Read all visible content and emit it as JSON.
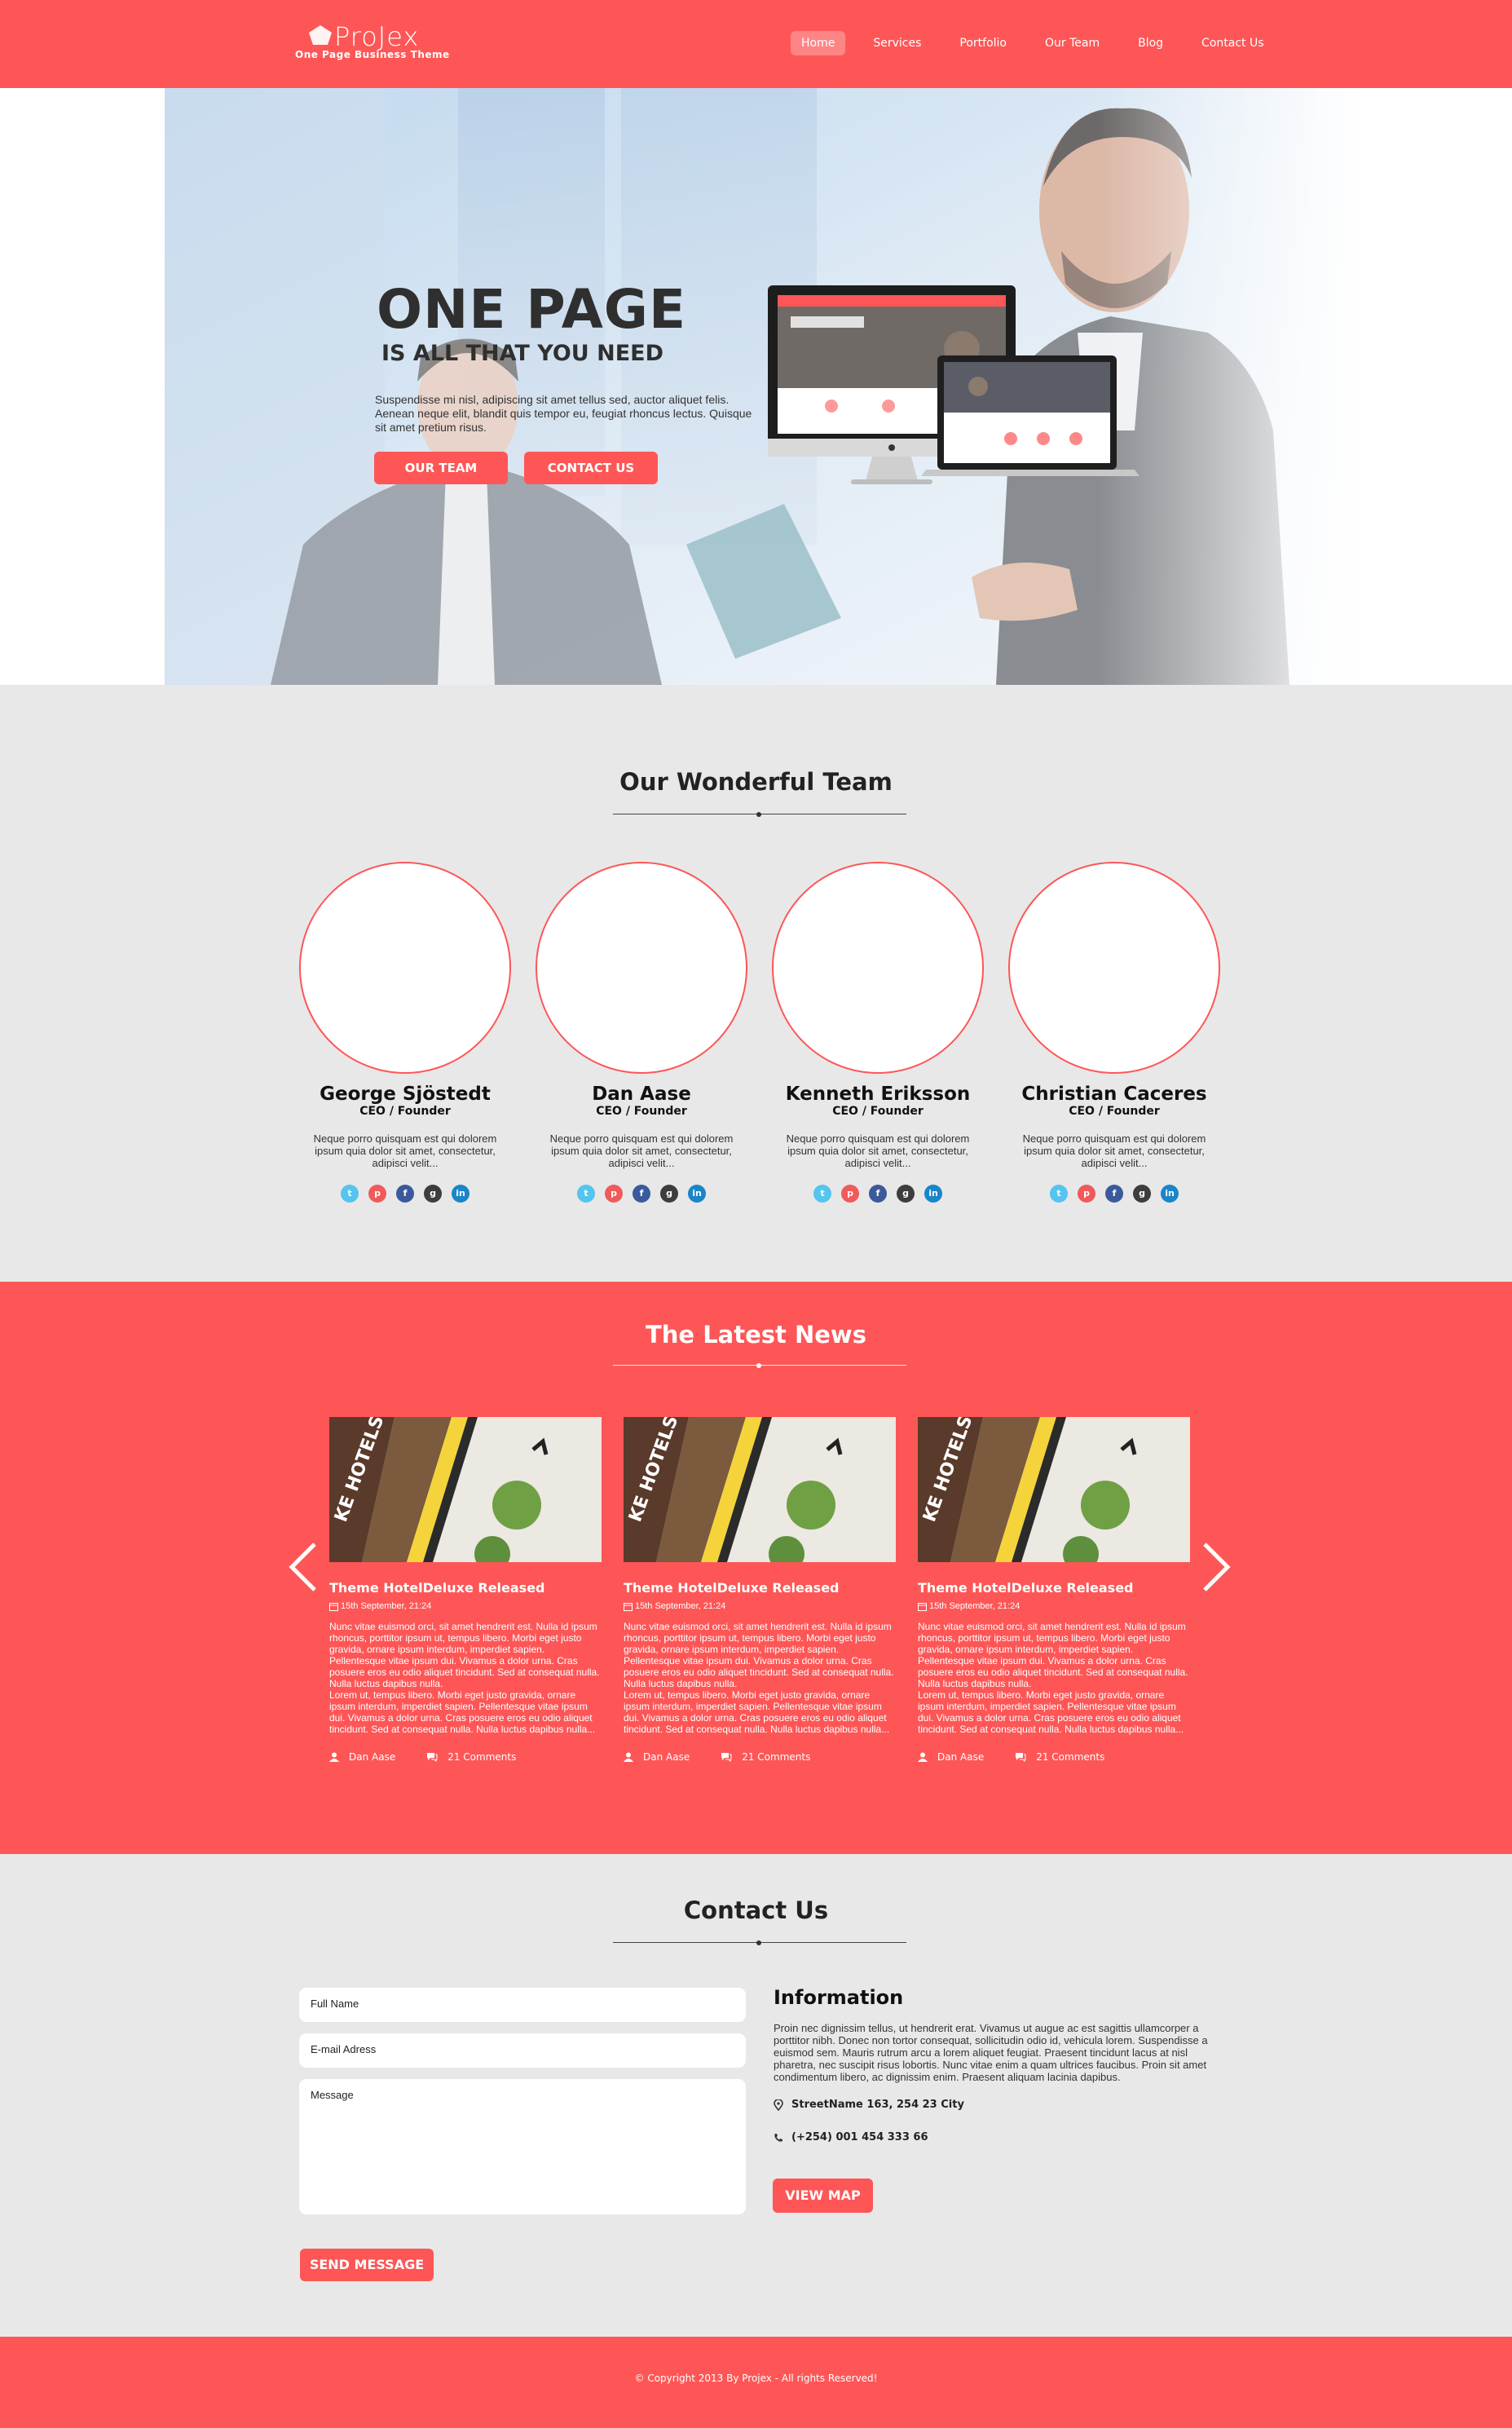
{
  "header": {
    "logo_name": "ProJex",
    "logo_tagline": "One Page Business Theme",
    "nav": [
      "Home",
      "Services",
      "Portfolio",
      "Our Team",
      "Blog",
      "Contact Us"
    ],
    "active_nav": "Home"
  },
  "hero": {
    "title": "ONE PAGE",
    "subtitle": "IS ALL THAT YOU NEED",
    "description": "Suspendisse mi nisl, adipiscing sit amet tellus sed, auctor aliquet felis. Aenean neque elit, blandit quis tempor eu, feugiat rhoncus lectus. Quisque sit amet pretium risus.",
    "button_team": "OUR TEAM",
    "button_contact": "CONTACT US"
  },
  "team": {
    "title": "Our Wonderful Team",
    "members": [
      {
        "name": "George Sjöstedt",
        "role": "CEO / Founder",
        "bio": "Neque porro quisquam est qui dolorem ipsum quia dolor sit amet, consectetur, adipisci velit..."
      },
      {
        "name": "Dan Aase",
        "role": "CEO / Founder",
        "bio": "Neque porro quisquam est qui dolorem ipsum quia dolor sit amet, consectetur, adipisci velit..."
      },
      {
        "name": "Kenneth Eriksson",
        "role": "CEO / Founder",
        "bio": "Neque porro quisquam est qui dolorem ipsum quia dolor sit amet, consectetur, adipisci velit..."
      },
      {
        "name": "Christian Caceres",
        "role": "CEO / Founder",
        "bio": "Neque porro quisquam est qui dolorem ipsum quia dolor sit amet, consectetur, adipisci velit..."
      }
    ],
    "social_icons": [
      "twitter-icon",
      "pinterest-icon",
      "facebook-icon",
      "google-plus-icon",
      "linkedin-icon"
    ]
  },
  "news": {
    "title": "The Latest News",
    "posts": [
      {
        "title": "Theme HotelDeluxe Released",
        "date": "15th September, 21:24",
        "body": "Nunc vitae euismod orci, sit amet hendrerit est. Nulla id ipsum rhoncus, porttitor ipsum ut, tempus libero. Morbi eget justo gravida, ornare ipsum interdum, imperdiet sapien. Pellentesque vitae ipsum dui. Vivamus a dolor urna. Cras posuere eros eu odio aliquet tincidunt. Sed at consequat nulla. Nulla luctus dapibus nulla.",
        "body2": "Lorem ut, tempus libero. Morbi eget justo gravida, ornare ipsum interdum, imperdiet sapien. Pellentesque vitae ipsum dui. Vivamus a dolor urna. Cras posuere eros eu odio aliquet tincidunt. Sed at consequat nulla. Nulla luctus dapibus nulla...",
        "author": "Dan Aase",
        "comments": "21 Comments",
        "image_text": "KE HOTELS"
      },
      {
        "title": "Theme HotelDeluxe Released",
        "date": "15th September, 21:24",
        "body": "Nunc vitae euismod orci, sit amet hendrerit est. Nulla id ipsum rhoncus, porttitor ipsum ut, tempus libero. Morbi eget justo gravida, ornare ipsum interdum, imperdiet sapien. Pellentesque vitae ipsum dui. Vivamus a dolor urna. Cras posuere eros eu odio aliquet tincidunt. Sed at consequat nulla. Nulla luctus dapibus nulla.",
        "body2": "Lorem ut, tempus libero. Morbi eget justo gravida, ornare ipsum interdum, imperdiet sapien. Pellentesque vitae ipsum dui. Vivamus a dolor urna. Cras posuere eros eu odio aliquet tincidunt. Sed at consequat nulla. Nulla luctus dapibus nulla...",
        "author": "Dan Aase",
        "comments": "21 Comments",
        "image_text": "KE HOTELS"
      },
      {
        "title": "Theme HotelDeluxe Released",
        "date": "15th September, 21:24",
        "body": "Nunc vitae euismod orci, sit amet hendrerit est. Nulla id ipsum rhoncus, porttitor ipsum ut, tempus libero. Morbi eget justo gravida, ornare ipsum interdum, imperdiet sapien. Pellentesque vitae ipsum dui. Vivamus a dolor urna. Cras posuere eros eu odio aliquet tincidunt. Sed at consequat nulla. Nulla luctus dapibus nulla.",
        "body2": "Lorem ut, tempus libero. Morbi eget justo gravida, ornare ipsum interdum, imperdiet sapien. Pellentesque vitae ipsum dui. Vivamus a dolor urna. Cras posuere eros eu odio aliquet tincidunt. Sed at consequat nulla. Nulla luctus dapibus nulla...",
        "author": "Dan Aase",
        "comments": "21 Comments",
        "image_text": "KE HOTELS"
      }
    ]
  },
  "contact": {
    "title": "Contact Us",
    "name_placeholder": "Full Name",
    "email_placeholder": "E-mail Adress",
    "message_placeholder": "Message",
    "send_button": "SEND MESSAGE",
    "info_title": "Information",
    "info_text": "Proin nec dignissim tellus, ut hendrerit erat. Vivamus ut augue ac est sagittis ullamcorper a porttitor nibh. Donec non tortor consequat, sollicitudin odio id, vehicula lorem. Suspendisse a euismod sem. Mauris rutrum arcu a lorem aliquet feugiat. Praesent tincidunt lacus at nisl pharetra, nec suscipit risus lobortis. Nunc vitae enim a quam ultrices faucibus. Proin sit amet condimentum libero, ac dignissim enim. Praesent aliquam lacinia dapibus.",
    "address": "StreetName 163, 254 23 City",
    "phone": "(+254) 001 454 333 66",
    "map_button": "VIEW MAP"
  },
  "footer": {
    "copyright": "© Copyright 2013 By Projex - All rights Reserved!"
  },
  "colors": {
    "accent": "#fe5656",
    "background": "#e8e8e8",
    "dark_text": "#2f2f2f"
  }
}
